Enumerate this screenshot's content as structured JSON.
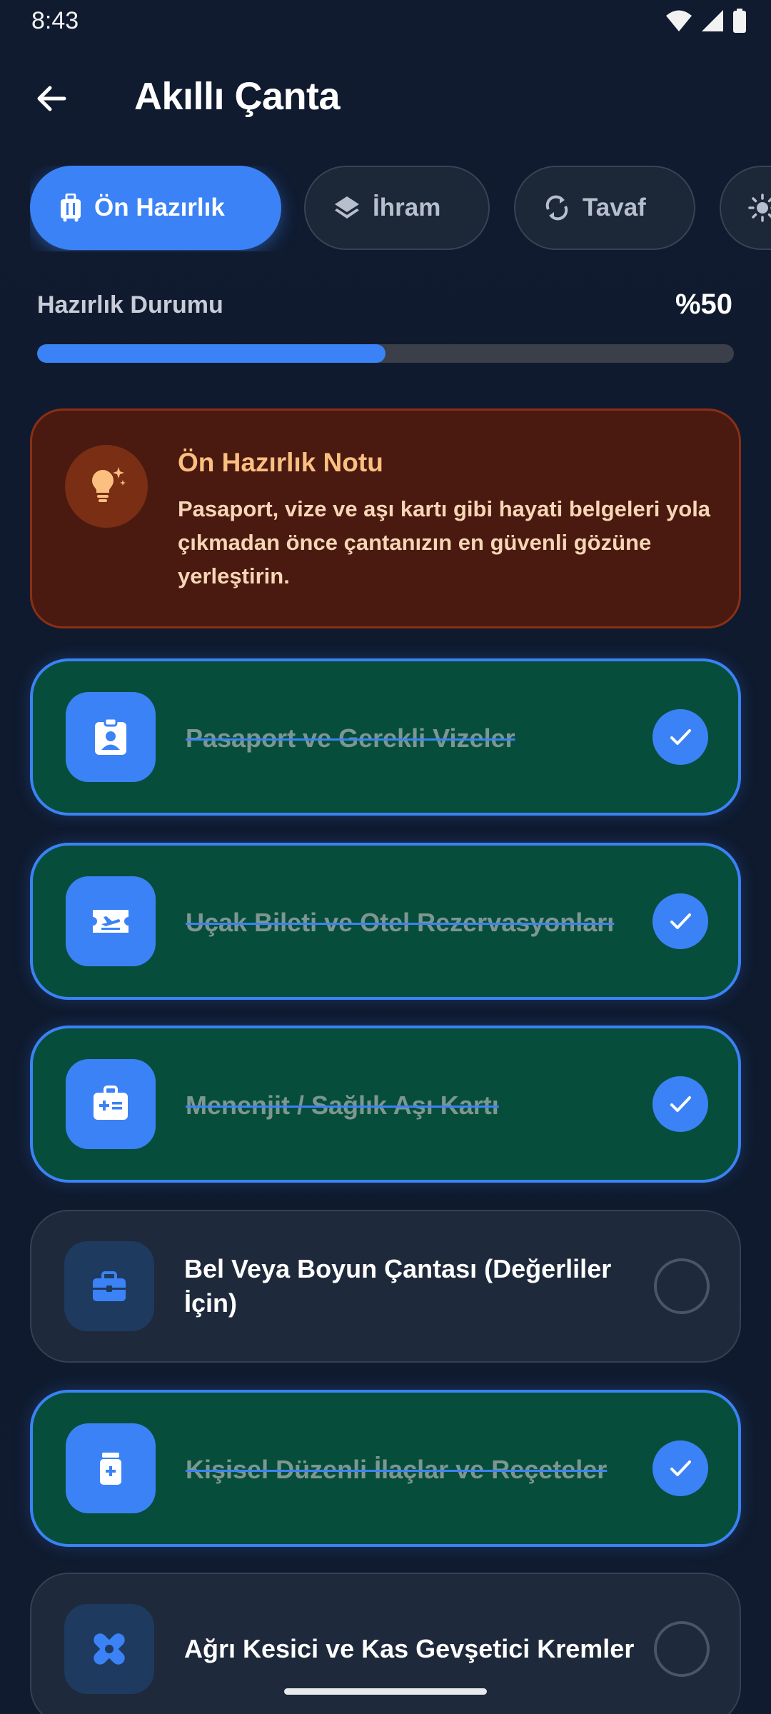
{
  "status_bar": {
    "time": "8:43",
    "icons": [
      "wifi-icon",
      "signal-icon",
      "battery-icon"
    ]
  },
  "app_bar": {
    "title": "Akıllı Çanta",
    "back_icon": "arrow-left-icon"
  },
  "tabs": [
    {
      "label": "Ön Hazırlık",
      "icon": "luggage-icon",
      "active": true
    },
    {
      "label": "İhram",
      "icon": "layers-icon",
      "active": false
    },
    {
      "label": "Tavaf",
      "icon": "sync-icon",
      "active": false
    },
    {
      "label": "",
      "icon": "sun-icon",
      "active": false
    }
  ],
  "progress": {
    "label": "Hazırlık Durumu",
    "value_text": "%50",
    "fraction": 0.5
  },
  "note": {
    "title": "Ön Hazırlık Notu",
    "text": "Pasaport, vize ve aşı kartı gibi hayati belgeleri yola çıkmadan önce çantanızın en güvenli gözüne yerleştirin.",
    "icon": "lightbulb-icon"
  },
  "items": [
    {
      "label": "Pasaport ve Gerekli Vizeler",
      "done": true,
      "icon": "id-badge-icon"
    },
    {
      "label": "Uçak Bileti ve Otel Rezervasyonları",
      "done": true,
      "icon": "airplane-ticket-icon"
    },
    {
      "label": "Menenjit / Sağlık Aşı Kartı",
      "done": true,
      "icon": "medical-kit-icon"
    },
    {
      "label": "Bel Veya Boyun Çantası (Değerliler İçin)",
      "done": false,
      "icon": "briefcase-icon"
    },
    {
      "label": "Kişisel Düzenli İlaçlar ve Reçeteler",
      "done": true,
      "icon": "medication-icon"
    },
    {
      "label": "Ağrı Kesici ve Kas Gevşetici Kremler",
      "done": false,
      "icon": "bandage-icon"
    }
  ],
  "colors": {
    "accent": "#3b82f6",
    "done_bg": "#064e3b",
    "todo_bg": "#1e293b",
    "note_bg": "#4a1a10",
    "note_title": "#fbbf80"
  }
}
